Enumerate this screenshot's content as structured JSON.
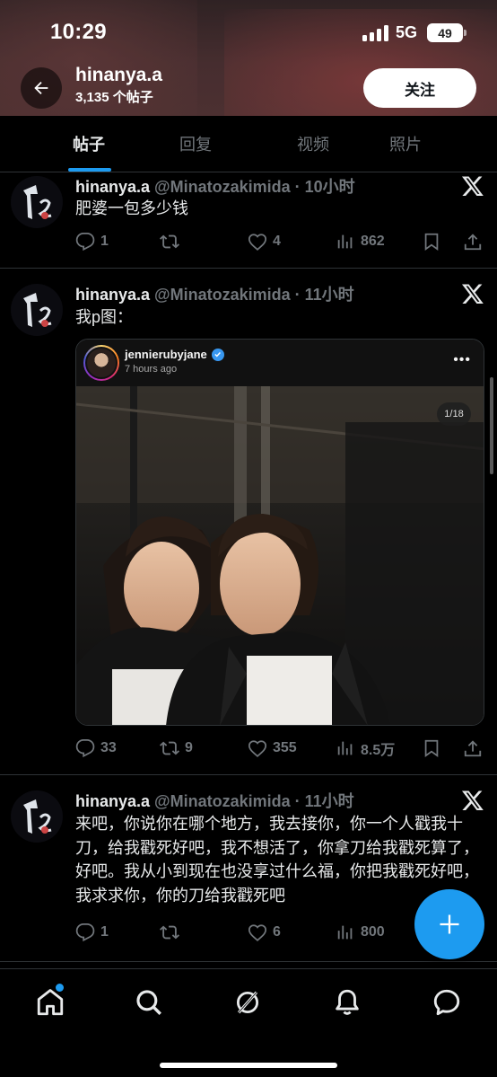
{
  "status_bar": {
    "time": "10:29",
    "network": "5G",
    "battery": "49"
  },
  "header": {
    "name": "hinanya.a",
    "post_count": "3,135 个帖子",
    "follow_label": "关注"
  },
  "tabs": [
    {
      "label": "帖子",
      "active": true
    },
    {
      "label": "回复",
      "active": false
    },
    {
      "label": "视频",
      "active": false
    },
    {
      "label": "照片",
      "active": false
    }
  ],
  "tweets": [
    {
      "name": "hinanya.a",
      "meta": "@Minatozakimida · 10小时",
      "text": "肥婆一包多少钱",
      "replies": "1",
      "reposts": "",
      "likes": "4",
      "views": "862"
    },
    {
      "name": "hinanya.a",
      "meta": "@Minatozakimida · 11小时",
      "text": "我p图：",
      "embed": {
        "username": "jennierubyjane",
        "time": "7 hours ago",
        "counter": "1/18"
      },
      "replies": "33",
      "reposts": "9",
      "likes": "355",
      "views": "8.5万"
    },
    {
      "name": "hinanya.a",
      "meta": "@Minatozakimida · 11小时",
      "text": "来吧，你说你在哪个地方，我去接你，你一个人戳我十刀，给我戳死好吧，我不想活了，你拿刀给我戳死算了，好吧。我从小到现在也没享过什么福，你把我戳死好吧，我求求你，你的刀给我戳死吧",
      "replies": "1",
      "reposts": "",
      "likes": "6",
      "views": "800"
    }
  ],
  "accent_color": "#1d9bf0"
}
